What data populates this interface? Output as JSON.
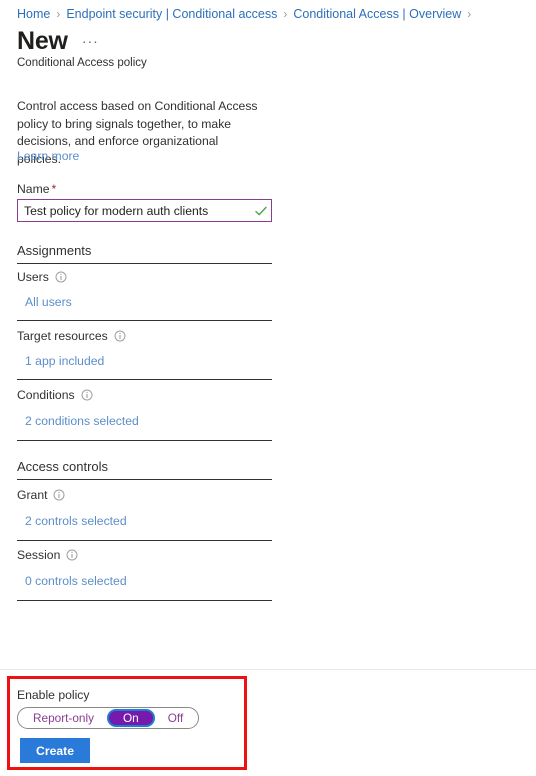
{
  "breadcrumb": {
    "separator": "›",
    "items": [
      {
        "label": "Home"
      },
      {
        "label": "Endpoint security | Conditional access"
      },
      {
        "label": "Conditional Access | Overview"
      }
    ]
  },
  "header": {
    "title": "New",
    "more_label": "···",
    "subtitle": "Conditional Access policy"
  },
  "intro": {
    "description": "Control access based on Conditional Access policy to bring signals together, to make decisions, and enforce organizational policies.",
    "learn_more": "Learn more"
  },
  "name_field": {
    "label": "Name",
    "required_marker": "*",
    "value": "Test policy for modern auth clients",
    "placeholder": "",
    "valid_icon": "checkmark-icon",
    "border_color": "#8a3d93",
    "check_color": "#4aa34a"
  },
  "sections": [
    {
      "heading": "Assignments",
      "rows": [
        {
          "label": "Users",
          "info_icon": "info-icon",
          "value": "All users"
        },
        {
          "label": "Target resources",
          "info_icon": "info-icon",
          "value": "1 app included"
        },
        {
          "label": "Conditions",
          "info_icon": "info-icon",
          "value": "2 conditions selected"
        }
      ]
    },
    {
      "heading": "Access controls",
      "rows": [
        {
          "label": "Grant",
          "info_icon": "info-icon",
          "value": "2 controls selected"
        },
        {
          "label": "Session",
          "info_icon": "info-icon",
          "value": "0 controls selected"
        }
      ]
    }
  ],
  "footer": {
    "enable_label": "Enable policy",
    "toggle": {
      "options": [
        "Report-only",
        "On",
        "Off"
      ],
      "selected": "On",
      "selected_bg": "#7719aa",
      "focus_ring": "#1a7fd4",
      "option_color": "#8a3d93"
    },
    "create_label": "Create",
    "create_color": "#2a7ad9",
    "highlight_color": "#ee1111"
  }
}
